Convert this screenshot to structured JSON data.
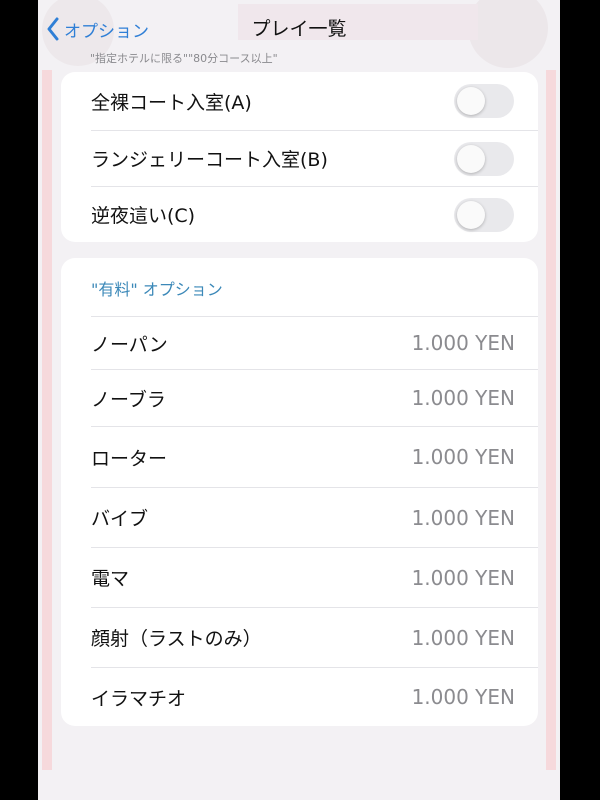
{
  "nav": {
    "back_label": "オプション",
    "title": "プレイ一覧",
    "subtitle": "\"指定ホテルに限る\"\"80分コース以上\""
  },
  "toggles": [
    {
      "label": "全裸コート入室(A)",
      "on": false
    },
    {
      "label": "ランジェリーコート入室(B)",
      "on": false
    },
    {
      "label": "逆夜這い(C)",
      "on": false
    }
  ],
  "paid": {
    "header": "\"有料\" オプション",
    "items": [
      {
        "label": "ノーパン",
        "price": "1.000 YEN"
      },
      {
        "label": "ノーブラ",
        "price": "1.000 YEN"
      },
      {
        "label": "ローター",
        "price": "1.000 YEN"
      },
      {
        "label": "バイブ",
        "price": "1.000 YEN"
      },
      {
        "label": "電マ",
        "price": "1.000 YEN"
      },
      {
        "label": "顔射（ラストのみ）",
        "price": "1.000 YEN"
      },
      {
        "label": "イラマチオ",
        "price": "1.000 YEN"
      }
    ]
  },
  "colors": {
    "accent": "#2f7fd6",
    "section_header": "#3b88b8",
    "toggle_off": "#e9e9ec",
    "price_text": "#8b8b8f",
    "background": "#f0eff4"
  }
}
